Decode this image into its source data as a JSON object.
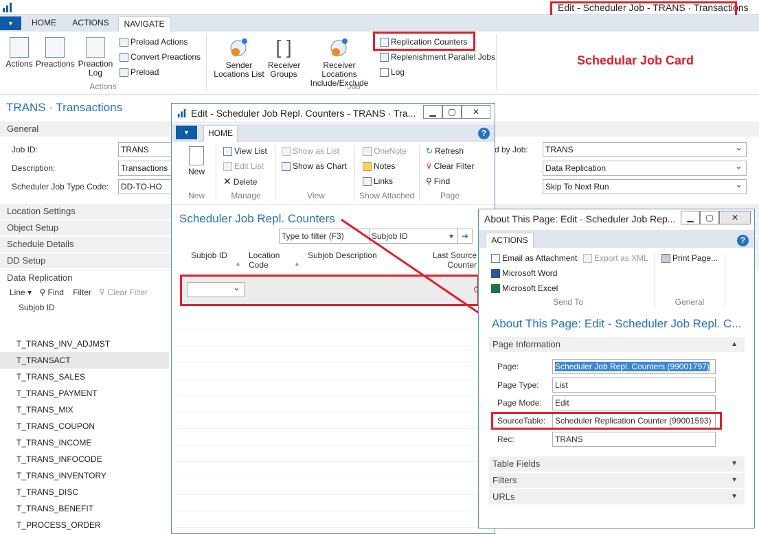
{
  "window_title": "Edit - Scheduler Job - TRANS · Transactions",
  "ribbon_tabs": [
    "HOME",
    "ACTIONS",
    "NAVIGATE"
  ],
  "actions_group": {
    "label": "Actions",
    "items": [
      "Actions",
      "Preactions",
      "Preaction Log"
    ]
  },
  "actions_small": [
    "Preload Actions",
    "Convert Preactions",
    "Preload"
  ],
  "job_group": {
    "label": "Job",
    "items": [
      "Sender Locations List",
      "Receiver Groups",
      "Receiver Locations Include/Exclude"
    ]
  },
  "job_small": [
    "Replication Counters",
    "Replenishment Parallel Jobs",
    "Log"
  ],
  "annotation": "Schedular Job Card",
  "page_title": "TRANS · Transactions",
  "general_tab": "General",
  "fields_left": [
    {
      "label": "Job ID:",
      "value": "TRANS"
    },
    {
      "label": "Description:",
      "value": "Transactions"
    },
    {
      "label": "Scheduler Job Type Code:",
      "value": "DD-TO-HO"
    }
  ],
  "fields_right": {
    "label": "d by Job:",
    "values": [
      "TRANS",
      "Data Replication",
      "Skip To Next Run"
    ]
  },
  "fasttabs": [
    "Location Settings",
    "Object Setup",
    "Schedule Details",
    "DD Setup",
    "Data Replication"
  ],
  "subpage_toolbar": {
    "line": "Line",
    "find": "Find",
    "filter": "Filter",
    "clear_filter": "Clear Filter"
  },
  "subjob_header": "Subjob ID",
  "subjobs": [
    "T_TRANS_INV_ADJMST",
    "T_TRANSACT",
    "T_TRANS_SALES",
    "T_TRANS_PAYMENT",
    "T_TRANS_MIX",
    "T_TRANS_COUPON",
    "T_TRANS_INCOME",
    "T_TRANS_INFOCODE",
    "T_TRANS_INVENTORY",
    "T_TRANS_DISC",
    "T_TRANS_BENEFIT",
    "T_PROCESS_ORDER"
  ],
  "counters_window": {
    "title": "Edit - Scheduler Job Repl. Counters - TRANS · Tra...",
    "tab": "HOME",
    "new": "New",
    "groups": [
      "New",
      "Manage",
      "View",
      "Show Attached",
      "Page"
    ],
    "manage": [
      "View List",
      "Edit List",
      "Delete"
    ],
    "view": [
      "Show as List",
      "Show as Chart"
    ],
    "attached": [
      "OneNote",
      "Notes",
      "Links"
    ],
    "page": [
      "Refresh",
      "Clear Filter",
      "Find"
    ],
    "heading": "Scheduler Job Repl. Counters",
    "filter_placeholder": "Type to filter (F3)",
    "filter_field": "Subjob ID",
    "columns": [
      "Subjob ID",
      "Location Code",
      "Subjob Description",
      "Last Source Counter"
    ],
    "row_value": "0"
  },
  "about_window": {
    "title": "About This Page: Edit - Scheduler Job Rep...",
    "tab": "ACTIONS",
    "send_to": [
      "Email as Attachment",
      "Microsoft Word",
      "Microsoft Excel"
    ],
    "export": "Export as XML",
    "print": "Print Page...",
    "groups": [
      "Send To",
      "General"
    ],
    "heading": "About This Page: Edit - Scheduler Job Repl. C...",
    "section": "Page Information",
    "fields": [
      {
        "label": "Page:",
        "value": "Scheduler Job Repl. Counters (99001797)"
      },
      {
        "label": "Page Type:",
        "value": "List"
      },
      {
        "label": "Page Mode:",
        "value": "Edit"
      },
      {
        "label": "SourceTable:",
        "value": "Scheduler Replication Counter (99001593)"
      },
      {
        "label": "Rec:",
        "value": "TRANS"
      }
    ],
    "collapsed": [
      "Table Fields",
      "Filters",
      "URLs"
    ]
  },
  "colors": {
    "accent": "#2672c3",
    "highlight": "#e0202a",
    "ribbon_blue": "#0e5ba8"
  }
}
